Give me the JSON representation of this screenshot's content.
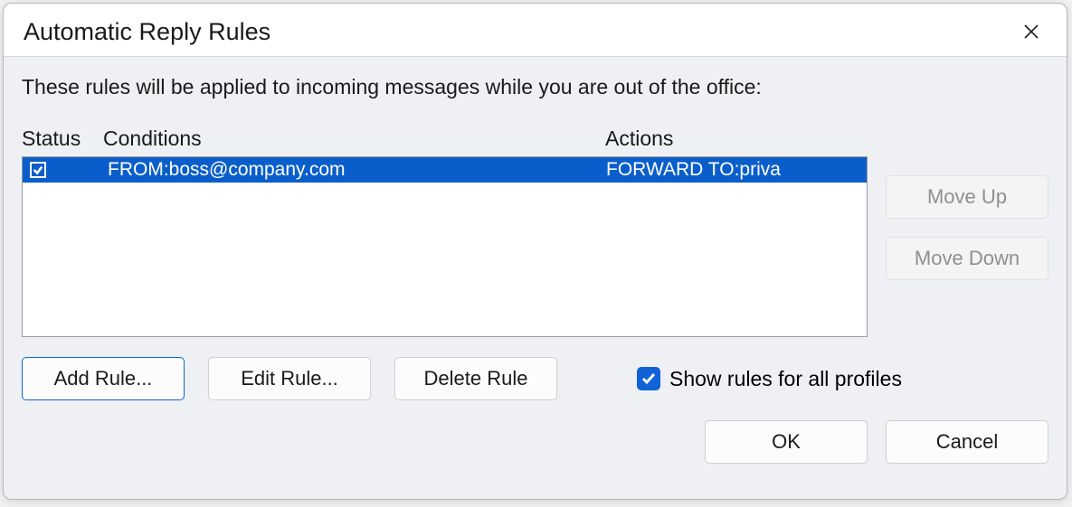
{
  "dialog": {
    "title": "Automatic Reply Rules",
    "description": "These rules will be applied to incoming messages while you are out of the office:"
  },
  "columns": {
    "status": "Status",
    "conditions": "Conditions",
    "actions": "Actions"
  },
  "rules": [
    {
      "enabled": true,
      "selected": true,
      "condition": "FROM:boss@company.com",
      "action": "FORWARD TO:priva"
    }
  ],
  "buttons": {
    "move_up": "Move Up",
    "move_down": "Move Down",
    "add": "Add Rule...",
    "edit": "Edit Rule...",
    "delete": "Delete Rule",
    "ok": "OK",
    "cancel": "Cancel"
  },
  "checkbox": {
    "show_all_label": "Show rules for all profiles",
    "show_all_checked": true
  },
  "state": {
    "move_up_enabled": false,
    "move_down_enabled": false
  }
}
